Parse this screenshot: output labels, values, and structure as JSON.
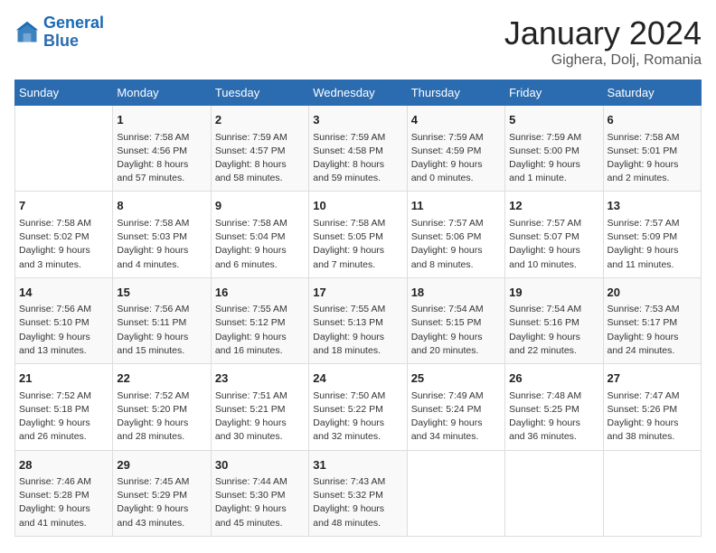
{
  "header": {
    "logo_line1": "General",
    "logo_line2": "Blue",
    "month": "January 2024",
    "location": "Gighera, Dolj, Romania"
  },
  "weekdays": [
    "Sunday",
    "Monday",
    "Tuesday",
    "Wednesday",
    "Thursday",
    "Friday",
    "Saturday"
  ],
  "weeks": [
    [
      {
        "day": "",
        "info": ""
      },
      {
        "day": "1",
        "info": "Sunrise: 7:58 AM\nSunset: 4:56 PM\nDaylight: 8 hours\nand 57 minutes."
      },
      {
        "day": "2",
        "info": "Sunrise: 7:59 AM\nSunset: 4:57 PM\nDaylight: 8 hours\nand 58 minutes."
      },
      {
        "day": "3",
        "info": "Sunrise: 7:59 AM\nSunset: 4:58 PM\nDaylight: 8 hours\nand 59 minutes."
      },
      {
        "day": "4",
        "info": "Sunrise: 7:59 AM\nSunset: 4:59 PM\nDaylight: 9 hours\nand 0 minutes."
      },
      {
        "day": "5",
        "info": "Sunrise: 7:59 AM\nSunset: 5:00 PM\nDaylight: 9 hours\nand 1 minute."
      },
      {
        "day": "6",
        "info": "Sunrise: 7:58 AM\nSunset: 5:01 PM\nDaylight: 9 hours\nand 2 minutes."
      }
    ],
    [
      {
        "day": "7",
        "info": "Sunrise: 7:58 AM\nSunset: 5:02 PM\nDaylight: 9 hours\nand 3 minutes."
      },
      {
        "day": "8",
        "info": "Sunrise: 7:58 AM\nSunset: 5:03 PM\nDaylight: 9 hours\nand 4 minutes."
      },
      {
        "day": "9",
        "info": "Sunrise: 7:58 AM\nSunset: 5:04 PM\nDaylight: 9 hours\nand 6 minutes."
      },
      {
        "day": "10",
        "info": "Sunrise: 7:58 AM\nSunset: 5:05 PM\nDaylight: 9 hours\nand 7 minutes."
      },
      {
        "day": "11",
        "info": "Sunrise: 7:57 AM\nSunset: 5:06 PM\nDaylight: 9 hours\nand 8 minutes."
      },
      {
        "day": "12",
        "info": "Sunrise: 7:57 AM\nSunset: 5:07 PM\nDaylight: 9 hours\nand 10 minutes."
      },
      {
        "day": "13",
        "info": "Sunrise: 7:57 AM\nSunset: 5:09 PM\nDaylight: 9 hours\nand 11 minutes."
      }
    ],
    [
      {
        "day": "14",
        "info": "Sunrise: 7:56 AM\nSunset: 5:10 PM\nDaylight: 9 hours\nand 13 minutes."
      },
      {
        "day": "15",
        "info": "Sunrise: 7:56 AM\nSunset: 5:11 PM\nDaylight: 9 hours\nand 15 minutes."
      },
      {
        "day": "16",
        "info": "Sunrise: 7:55 AM\nSunset: 5:12 PM\nDaylight: 9 hours\nand 16 minutes."
      },
      {
        "day": "17",
        "info": "Sunrise: 7:55 AM\nSunset: 5:13 PM\nDaylight: 9 hours\nand 18 minutes."
      },
      {
        "day": "18",
        "info": "Sunrise: 7:54 AM\nSunset: 5:15 PM\nDaylight: 9 hours\nand 20 minutes."
      },
      {
        "day": "19",
        "info": "Sunrise: 7:54 AM\nSunset: 5:16 PM\nDaylight: 9 hours\nand 22 minutes."
      },
      {
        "day": "20",
        "info": "Sunrise: 7:53 AM\nSunset: 5:17 PM\nDaylight: 9 hours\nand 24 minutes."
      }
    ],
    [
      {
        "day": "21",
        "info": "Sunrise: 7:52 AM\nSunset: 5:18 PM\nDaylight: 9 hours\nand 26 minutes."
      },
      {
        "day": "22",
        "info": "Sunrise: 7:52 AM\nSunset: 5:20 PM\nDaylight: 9 hours\nand 28 minutes."
      },
      {
        "day": "23",
        "info": "Sunrise: 7:51 AM\nSunset: 5:21 PM\nDaylight: 9 hours\nand 30 minutes."
      },
      {
        "day": "24",
        "info": "Sunrise: 7:50 AM\nSunset: 5:22 PM\nDaylight: 9 hours\nand 32 minutes."
      },
      {
        "day": "25",
        "info": "Sunrise: 7:49 AM\nSunset: 5:24 PM\nDaylight: 9 hours\nand 34 minutes."
      },
      {
        "day": "26",
        "info": "Sunrise: 7:48 AM\nSunset: 5:25 PM\nDaylight: 9 hours\nand 36 minutes."
      },
      {
        "day": "27",
        "info": "Sunrise: 7:47 AM\nSunset: 5:26 PM\nDaylight: 9 hours\nand 38 minutes."
      }
    ],
    [
      {
        "day": "28",
        "info": "Sunrise: 7:46 AM\nSunset: 5:28 PM\nDaylight: 9 hours\nand 41 minutes."
      },
      {
        "day": "29",
        "info": "Sunrise: 7:45 AM\nSunset: 5:29 PM\nDaylight: 9 hours\nand 43 minutes."
      },
      {
        "day": "30",
        "info": "Sunrise: 7:44 AM\nSunset: 5:30 PM\nDaylight: 9 hours\nand 45 minutes."
      },
      {
        "day": "31",
        "info": "Sunrise: 7:43 AM\nSunset: 5:32 PM\nDaylight: 9 hours\nand 48 minutes."
      },
      {
        "day": "",
        "info": ""
      },
      {
        "day": "",
        "info": ""
      },
      {
        "day": "",
        "info": ""
      }
    ]
  ]
}
